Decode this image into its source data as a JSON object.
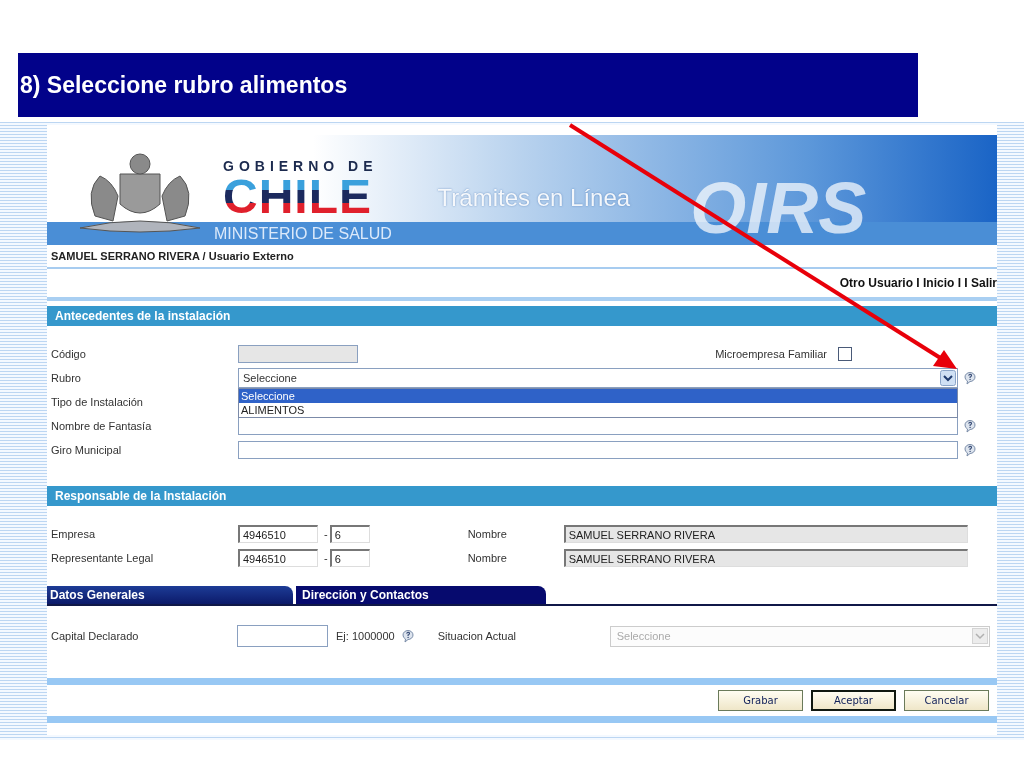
{
  "slide_title": "8) Seleccione rubro alimentos",
  "header": {
    "logo_top": "GOBIERNO DE",
    "logo_main": "CHILE",
    "ministry": "MINISTERIO DE SALUD",
    "tagline": "Trámites en Línea",
    "app_name": "OIRS"
  },
  "user_line": "SAMUEL SERRANO RIVERA / Usuario Externo",
  "nav": "Otro Usuario I Inicio I I Salir",
  "installation": {
    "title": "Antecedentes de la instalación",
    "codigo": {
      "label": "Código",
      "disabled": true
    },
    "microempresa": {
      "label": "Microempresa Familiar",
      "checked": false
    },
    "rubro": {
      "label": "Rubro",
      "value": "Seleccione",
      "expanded": true,
      "options": [
        {
          "label": "Seleccione",
          "selected": true
        },
        {
          "label": "ALIMENTOS",
          "selected": false
        }
      ]
    },
    "tipo": {
      "label": "Tipo de Instalación"
    },
    "fantasia": {
      "label": "Nombre de Fantasía"
    },
    "giro": {
      "label": "Giro Municipal"
    }
  },
  "responsable": {
    "title": "Responsable de la Instalación",
    "rows": [
      {
        "label": "Empresa",
        "rut": "4946510",
        "separator": "-",
        "dv": "6",
        "name_label": "Nombre",
        "name": "SAMUEL SERRANO RIVERA"
      },
      {
        "label": "Representante Legal",
        "rut": "4946510",
        "separator": "-",
        "dv": "6",
        "name_label": "Nombre",
        "name": "SAMUEL SERRANO RIVERA"
      }
    ]
  },
  "tabs": [
    {
      "label": "Datos Generales",
      "selected": true
    },
    {
      "label": "Dirección y Contactos",
      "selected": false
    }
  ],
  "general": {
    "capital": {
      "label": "Capital Declarado",
      "hint": "Ej: 1000000"
    },
    "situacion": {
      "label": "Situacion Actual",
      "value": "Seleccione",
      "disabled": true
    }
  },
  "buttons": [
    {
      "label": "Grabar",
      "selected": false
    },
    {
      "label": "Aceptar",
      "selected": true
    },
    {
      "label": "Cancelar",
      "selected": false
    }
  ]
}
